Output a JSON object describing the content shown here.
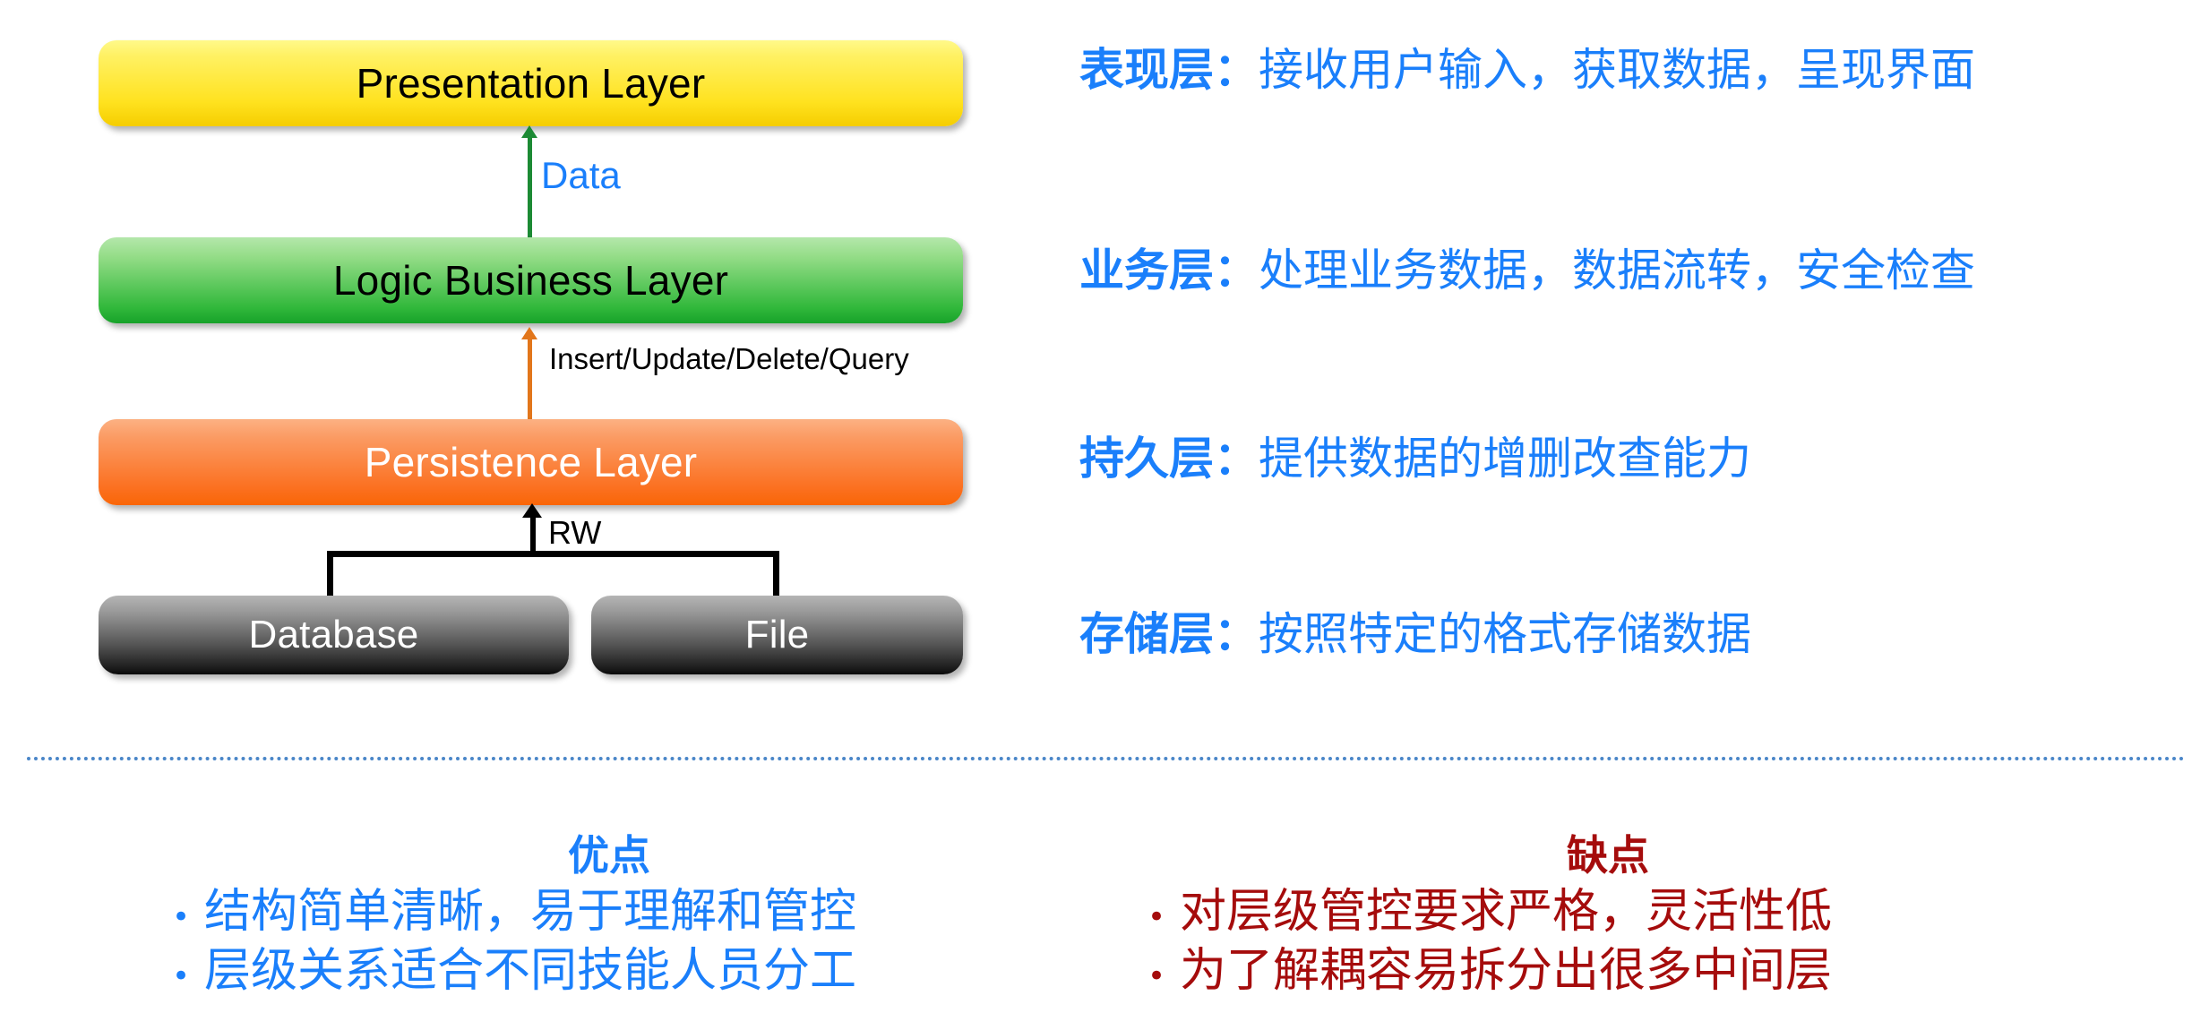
{
  "diagram": {
    "layers": [
      {
        "id": "presentation",
        "label": "Presentation Layer",
        "color": "#ffe21f"
      },
      {
        "id": "logic",
        "label": "Logic Business Layer",
        "color": "#31b83b"
      },
      {
        "id": "persistence",
        "label": "Persistence Layer",
        "color": "#fb7020"
      }
    ],
    "storage": [
      {
        "id": "database",
        "label": "Database",
        "color": "#555555"
      },
      {
        "id": "file",
        "label": "File",
        "color": "#555555"
      }
    ],
    "connectors": [
      {
        "id": "data",
        "label": "Data",
        "color": "#1c8a34",
        "text_color": "#1a7ffb"
      },
      {
        "id": "crud",
        "label": "Insert/Update/Delete/Query",
        "color": "#e2761b",
        "text_color": "#000000"
      },
      {
        "id": "rw",
        "label": "RW",
        "color": "#000000",
        "text_color": "#000000"
      }
    ]
  },
  "descriptions": {
    "accent_color": "#1a7ffb",
    "items": [
      {
        "head": "表现层：",
        "body": "接收用户输入，获取数据，呈现界面"
      },
      {
        "head": "业务层：",
        "body": "处理业务数据，数据流转，安全检查"
      },
      {
        "head": "持久层：",
        "body": "提供数据的增删改查能力"
      },
      {
        "head": "存储层：",
        "body": "按照特定的格式存储数据"
      }
    ]
  },
  "summary": {
    "pros": {
      "title": "优点",
      "color": "#1a7ffb",
      "bullet": "•",
      "items": [
        "结构简单清晰，易于理解和管控",
        "层级关系适合不同技能人员分工"
      ]
    },
    "cons": {
      "title": "缺点",
      "color": "#a50c0c",
      "bullet": "•",
      "items": [
        "对层级管控要求严格，灵活性低",
        "为了解耦容易拆分出很多中间层"
      ]
    }
  }
}
